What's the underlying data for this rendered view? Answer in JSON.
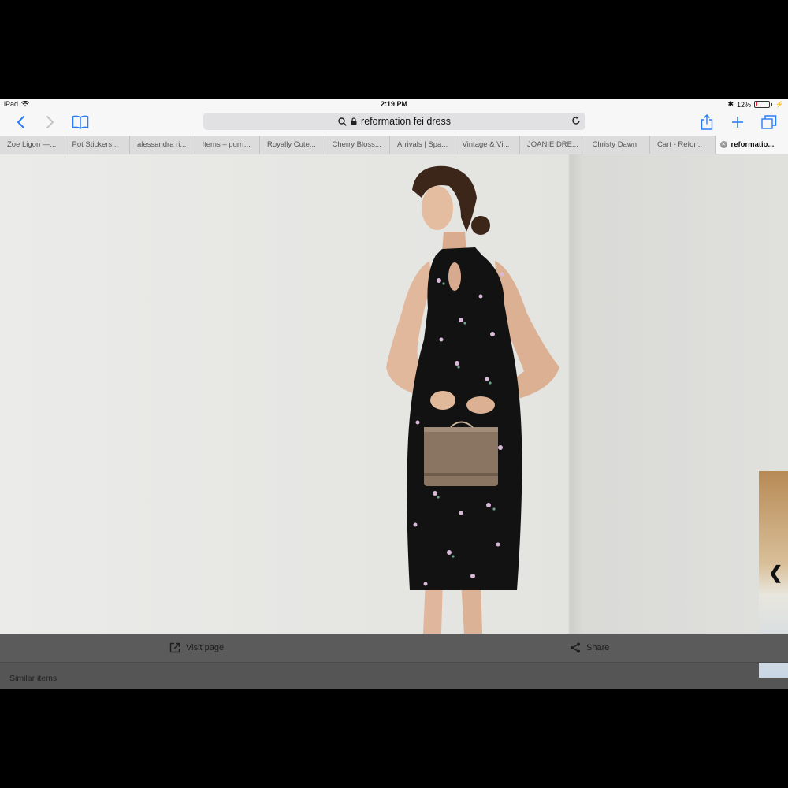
{
  "status": {
    "device": "iPad",
    "time": "2:19 PM",
    "battery": "12%",
    "battery_level": 0.12
  },
  "toolbar": {
    "url_text": "reformation fei dress"
  },
  "tabs": [
    {
      "label": "Zoe Ligon —..."
    },
    {
      "label": "Pot Stickers..."
    },
    {
      "label": "alessandra ri..."
    },
    {
      "label": "Items – purrr..."
    },
    {
      "label": "Royally Cute..."
    },
    {
      "label": "Cherry Bloss..."
    },
    {
      "label": "Arrivals | Spa..."
    },
    {
      "label": "Vintage & Vi..."
    },
    {
      "label": "JOANIE DRE..."
    },
    {
      "label": "Christy Dawn"
    },
    {
      "label": "Cart - Refor..."
    },
    {
      "label": "reformatio...",
      "active": true
    }
  ],
  "image_actions": {
    "visit_label": "Visit page",
    "share_label": "Share"
  },
  "similar_label": "Similar items",
  "colors": {
    "accent": "#2b7cf6",
    "dress": "#121212",
    "bag": "#8a7562"
  }
}
